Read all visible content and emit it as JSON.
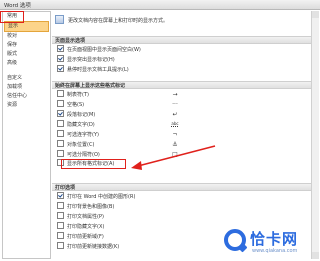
{
  "window": {
    "title": "Word 选项"
  },
  "sidebar": {
    "items": [
      {
        "label": "常用"
      },
      {
        "label": "显示",
        "selected": true
      },
      {
        "label": "校对"
      },
      {
        "label": "保存"
      },
      {
        "label": "版式"
      },
      {
        "label": "高级"
      },
      {
        "label": "自定义"
      },
      {
        "label": "加载项"
      },
      {
        "label": "信任中心"
      },
      {
        "label": "资源"
      }
    ]
  },
  "intro": {
    "text": "更改文档内容在屏幕上和打印时的显示方式。"
  },
  "sections": {
    "page_display": {
      "title": "页面显示选项",
      "options": [
        {
          "label": "在页面视图中显示页面间空白(W)",
          "checked": true
        },
        {
          "label": "显示突出显示标记(H)",
          "checked": true
        },
        {
          "label": "悬停时显示文档工具提示(L)",
          "checked": true
        }
      ]
    },
    "formatting_marks": {
      "title": "始终在屏幕上显示这些格式标记",
      "options": [
        {
          "label": "制表符(T)",
          "checked": false,
          "symbol": "→"
        },
        {
          "label": "空格(S)",
          "checked": false,
          "symbol": "···"
        },
        {
          "label": "段落标记(M)",
          "checked": true,
          "symbol": "↵"
        },
        {
          "label": "隐藏文字(D)",
          "checked": false,
          "symbol": "abc"
        },
        {
          "label": "可选连字符(Y)",
          "checked": false,
          "symbol": "¬"
        },
        {
          "label": "对象位置(C)",
          "checked": false,
          "symbol": "⚓"
        },
        {
          "label": "可选分隔符(O)",
          "checked": false,
          "symbol": "□"
        },
        {
          "label": "显示所有格式标记(A)",
          "checked": false,
          "symbol": ""
        }
      ]
    },
    "printing": {
      "title": "打印选项",
      "options": [
        {
          "label": "打印在 Word 中创建的图形(R)",
          "checked": true
        },
        {
          "label": "打印背景色和图像(B)",
          "checked": false
        },
        {
          "label": "打印文档属性(P)",
          "checked": false
        },
        {
          "label": "打印隐藏文字(X)",
          "checked": false
        },
        {
          "label": "打印前更新域(F)",
          "checked": false
        },
        {
          "label": "打印前更新链接数据(K)",
          "checked": false
        }
      ]
    }
  },
  "colors": {
    "accent": "#e0211c",
    "selected_bg": "#fcd48a",
    "brand": "#2d6cdf"
  },
  "watermark": {
    "name": "恰卡网",
    "url": "www.qiakana.com"
  }
}
